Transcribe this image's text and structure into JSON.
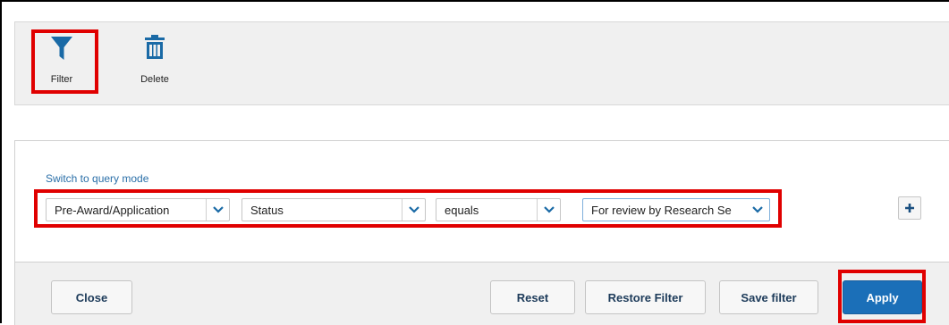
{
  "toolbar": {
    "filter_label": "Filter",
    "delete_label": "Delete"
  },
  "filter": {
    "query_link": "Switch to query mode",
    "selects": [
      {
        "value": "Pre-Award/Application"
      },
      {
        "value": "Status"
      },
      {
        "value": "equals"
      },
      {
        "value": "For review by Research Se"
      }
    ],
    "add_label": "+"
  },
  "footer": {
    "close_label": "Close",
    "reset_label": "Reset",
    "restore_label": "Restore Filter",
    "save_label": "Save filter",
    "apply_label": "Apply"
  },
  "colors": {
    "accent": "#1b6fb8",
    "highlight": "#e00000",
    "icon": "#1a6aa6"
  }
}
